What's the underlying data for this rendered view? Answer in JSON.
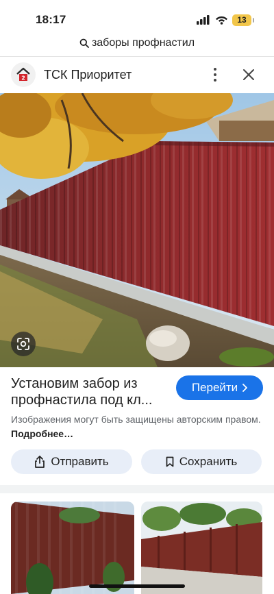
{
  "status_bar": {
    "time": "18:17",
    "battery": "13",
    "battery_color": "#f2c64a"
  },
  "search": {
    "query": "заборы профнастил",
    "icon": "search-icon"
  },
  "site": {
    "name": "ТСК Приоритет",
    "logo_icon": "house-logo-icon",
    "menu_icon": "more-vert-icon",
    "close_icon": "close-icon"
  },
  "image": {
    "description_icon": "lens-icon"
  },
  "result": {
    "title": "Установим забор из профнастила под кл...",
    "visit_label": "Перейти",
    "visit_icon": "chevron-right-icon",
    "copyright_text": "Изображения могут быть защищены авторским правом.",
    "more_link": "Подробнее…"
  },
  "actions": {
    "share_label": "Отправить",
    "save_label": "Сохранить"
  },
  "colors": {
    "accent": "#1a73e8",
    "pill_bg": "#e8eef8",
    "fence_red": "#8e2a2c"
  }
}
